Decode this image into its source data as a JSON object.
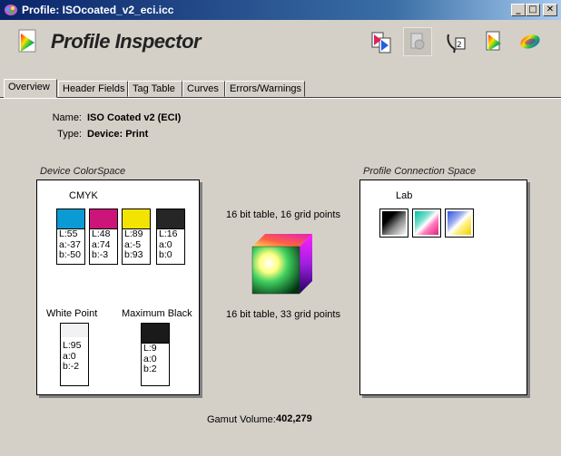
{
  "window": {
    "title": "Profile: ISOcoated_v2_eci.icc",
    "minimize": "_",
    "maximize": "□",
    "close": "✕"
  },
  "app": {
    "name": "Profile Inspector"
  },
  "toolbar": {
    "buttons": [
      {
        "icon": "compare-profiles-icon"
      },
      {
        "icon": "disabled-tool-icon"
      },
      {
        "icon": "measure-icon"
      },
      {
        "icon": "gamut-plot-icon"
      },
      {
        "icon": "3d-gamut-icon"
      }
    ]
  },
  "tabs": [
    "Overview",
    "Header Fields",
    "Tag Table",
    "Curves",
    "Errors/Warnings"
  ],
  "active_tab": "Overview",
  "info": {
    "name_label": "Name:",
    "name_value": "ISO Coated v2 (ECI)",
    "type_label": "Type:",
    "type_value": "Device: Print"
  },
  "device_colorspace": {
    "title": "Device ColorSpace",
    "space": "CMYK",
    "colorants": [
      {
        "color": "#0a9bd4",
        "L": "L:55",
        "a": "a:-37",
        "b": "b:-50"
      },
      {
        "color": "#cc1479",
        "L": "L:48",
        "a": "a:74",
        "b": "b:-3"
      },
      {
        "color": "#f2e400",
        "L": "L:89",
        "a": "a:-5",
        "b": "b:93"
      },
      {
        "color": "#262626",
        "L": "L:16",
        "a": "a:0",
        "b": "b:0"
      }
    ],
    "white_point": {
      "label": "White Point",
      "color": "#f2f2f4",
      "L": "L:95",
      "a": "a:0",
      "b": "b:-2"
    },
    "maximum_black": {
      "label": "Maximum Black",
      "color": "#1a1a1a",
      "L": "L:9",
      "a": "a:0",
      "b": "b:2"
    }
  },
  "transform": {
    "top": "16 bit table, 16 grid points",
    "bottom": "16 bit table, 33 grid points"
  },
  "pcs": {
    "title": "Profile Connection Space",
    "space": "Lab"
  },
  "gamut": {
    "label": "Gamut Volume:",
    "value": "402,279"
  }
}
